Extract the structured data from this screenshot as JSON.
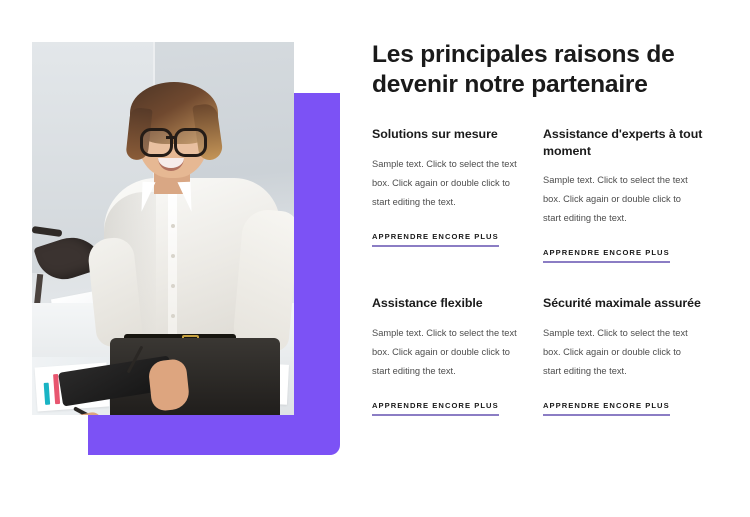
{
  "theme": {
    "accent_purple": "#7C52F5",
    "link_underline": "#8B7DC4",
    "heading_color": "#1A1A1A",
    "body_color": "#4D4D4D",
    "page_background": "#FFFFFF"
  },
  "hero": {
    "headline": "Les principales raisons de devenir notre partenaire",
    "image_alt": "Femme d'affaires souriante avec des lunettes tenant une tablette dans un bureau"
  },
  "cards": [
    {
      "title": "Solutions sur mesure",
      "body": "Sample text. Click to select the text box. Click again or double click to start editing the text.",
      "link_label": "APPRENDRE ENCORE PLUS"
    },
    {
      "title": "Assistance d'experts à tout moment",
      "body": "Sample text. Click to select the text box. Click again or double click to start editing the text.",
      "link_label": "APPRENDRE ENCORE PLUS"
    },
    {
      "title": "Assistance flexible",
      "body": "Sample text. Click to select the text box. Click again or double click to start editing the text.",
      "link_label": "APPRENDRE ENCORE PLUS"
    },
    {
      "title": "Sécurité maximale assurée",
      "body": "Sample text. Click to select the text box. Click again or double click to start editing the text.",
      "link_label": "APPRENDRE ENCORE PLUS"
    }
  ]
}
